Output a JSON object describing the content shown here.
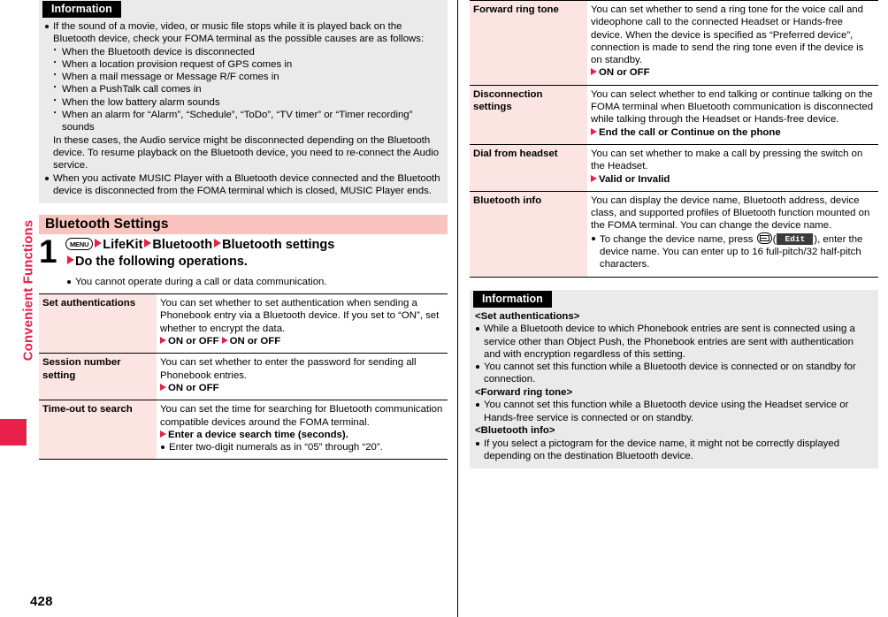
{
  "sidebar": {
    "chapter_label": "Convenient Functions",
    "page_number": "428"
  },
  "left_column": {
    "information": {
      "badge": "Information",
      "items": [
        {
          "type": "bullet",
          "text": "If the sound of a movie, video, or music file stops while it is played back on the Bluetooth device, check your FOMA terminal as the possible causes are as follows:"
        },
        {
          "type": "dash",
          "text": "When the Bluetooth device is disconnected"
        },
        {
          "type": "dash",
          "text": "When a location provision request of GPS comes in"
        },
        {
          "type": "dash",
          "text": "When a mail message or Message R/F comes in"
        },
        {
          "type": "dash",
          "text": "When a PushTalk call comes in"
        },
        {
          "type": "dash",
          "text": "When the low battery alarm sounds"
        },
        {
          "type": "dash",
          "text": "When an alarm for “Alarm”, “Schedule”, “ToDo”, “TV timer” or “Timer recording” sounds"
        },
        {
          "type": "plain",
          "text": "In these cases, the Audio service might be disconnected depending on the Bluetooth device. To resume playback on the Bluetooth device, you need to re-connect the Audio service."
        },
        {
          "type": "bullet",
          "text": "When you activate MUSIC Player with a Bluetooth device connected and the Bluetooth device is disconnected from the FOMA terminal which is closed, MUSIC Player ends."
        }
      ]
    },
    "section": {
      "title": "Bluetooth Settings",
      "step_number": "1",
      "key_label": "MENU",
      "step_line1_parts": [
        "LifeKit",
        "Bluetooth",
        "Bluetooth settings"
      ],
      "step_line2": "Do the following operations.",
      "step_note": "You cannot operate during a call or data communication."
    },
    "settings_table": [
      {
        "label": "Set authentications",
        "description": "You can set whether to set authentication when sending a Phonebook entry via a Bluetooth device. If you set to “ON”, set whether to encrypt the data.",
        "options": [
          "ON or OFF",
          "ON or OFF"
        ]
      },
      {
        "label": "Session number setting",
        "description": "You can set whether to enter the password for sending all Phonebook entries.",
        "options": [
          "ON or OFF"
        ]
      },
      {
        "label": "Time-out to search",
        "description": "You can set the time for searching for Bluetooth communication compatible devices around the FOMA terminal.",
        "options": [
          "Enter a device search time (seconds)."
        ],
        "note": "Enter two-digit numerals as in “05” through “20”."
      }
    ]
  },
  "right_column": {
    "settings_table": [
      {
        "label": "Forward ring tone",
        "description": "You can set whether to send a ring tone for the voice call and videophone call to the connected Headset or Hands-free device. When the device is specified as “Preferred device”, connection is made to send the ring tone even if the device is on standby.",
        "options": [
          "ON or OFF"
        ]
      },
      {
        "label": "Disconnection settings",
        "description": "You can select whether to end talking or continue talking on the FOMA terminal when Bluetooth communication is disconnected while talking through the Headset or Hands-free device.",
        "options": [
          "End the call or Continue on the phone"
        ]
      },
      {
        "label": "Dial from headset",
        "description": "You can set whether to make a call by pressing the switch on the Headset.",
        "options": [
          "Valid or Invalid"
        ]
      },
      {
        "label": "Bluetooth info",
        "description": "You can display the device name, Bluetooth address, device class, and supported profiles of Bluetooth function mounted on the FOMA terminal. You can change the device name.",
        "options": [],
        "note_prefix": "To change the device name, press ",
        "note_key_icon": "mail-key-icon",
        "note_softkey": "Edit",
        "note_suffix": "), enter the device name. You can enter up to 16 full-pitch/32 half-pitch characters."
      }
    ],
    "information": {
      "badge": "Information",
      "groups": [
        {
          "heading": "<Set authentications>",
          "items": [
            "While a Bluetooth device to which Phonebook entries are sent is connected using a service other than Object Push, the Phonebook entries are sent with authentication and with encryption regardless of this setting.",
            "You cannot set this function while a Bluetooth device is connected or on standby for connection."
          ]
        },
        {
          "heading": "<Forward ring tone>",
          "items": [
            "You cannot set this function while a Bluetooth device using the Headset service or Hands-free service is connected or on standby."
          ]
        },
        {
          "heading": "<Bluetooth info>",
          "items": [
            "If you select a pictogram for the device name, it might not be correctly displayed depending on the destination Bluetooth device."
          ]
        }
      ]
    }
  },
  "colors": {
    "accent_red": "#e8204a",
    "section_bar": "#f8c4bd",
    "label_cell": "#fbe4e1",
    "info_panel": "#eaeaea"
  }
}
